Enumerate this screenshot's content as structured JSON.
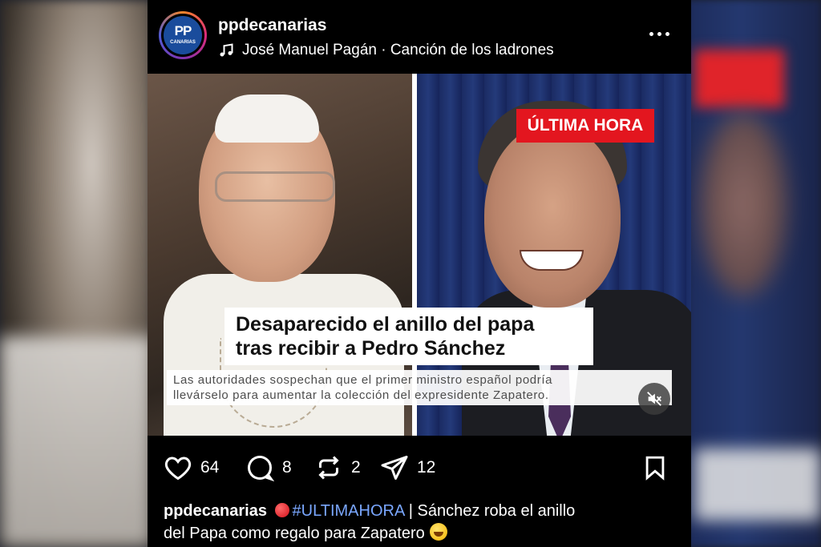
{
  "post": {
    "username": "ppdecanarias",
    "avatar_text": "PP",
    "avatar_subtext": "CANARIAS",
    "music": "José Manuel Pagán · Canción de los ladrones"
  },
  "media": {
    "badge": "ÚLTIMA HORA",
    "headline_line1": "Desaparecido el anillo del papa",
    "headline_line2": "tras recibir a Pedro Sánchez",
    "subtext_line1": "Las autoridades sospechan que el primer ministro español podría",
    "subtext_line2": "llevárselo para aumentar la colección del expresidente Zapatero."
  },
  "actions": {
    "likes": "64",
    "comments": "8",
    "reposts": "2",
    "shares": "12"
  },
  "caption": {
    "username": "ppdecanarias",
    "hashtag": "#ULTIMAHORA",
    "text_before_break": " | Sánchez roba el anillo",
    "text_after_break": "del Papa como regalo para Zapatero"
  }
}
